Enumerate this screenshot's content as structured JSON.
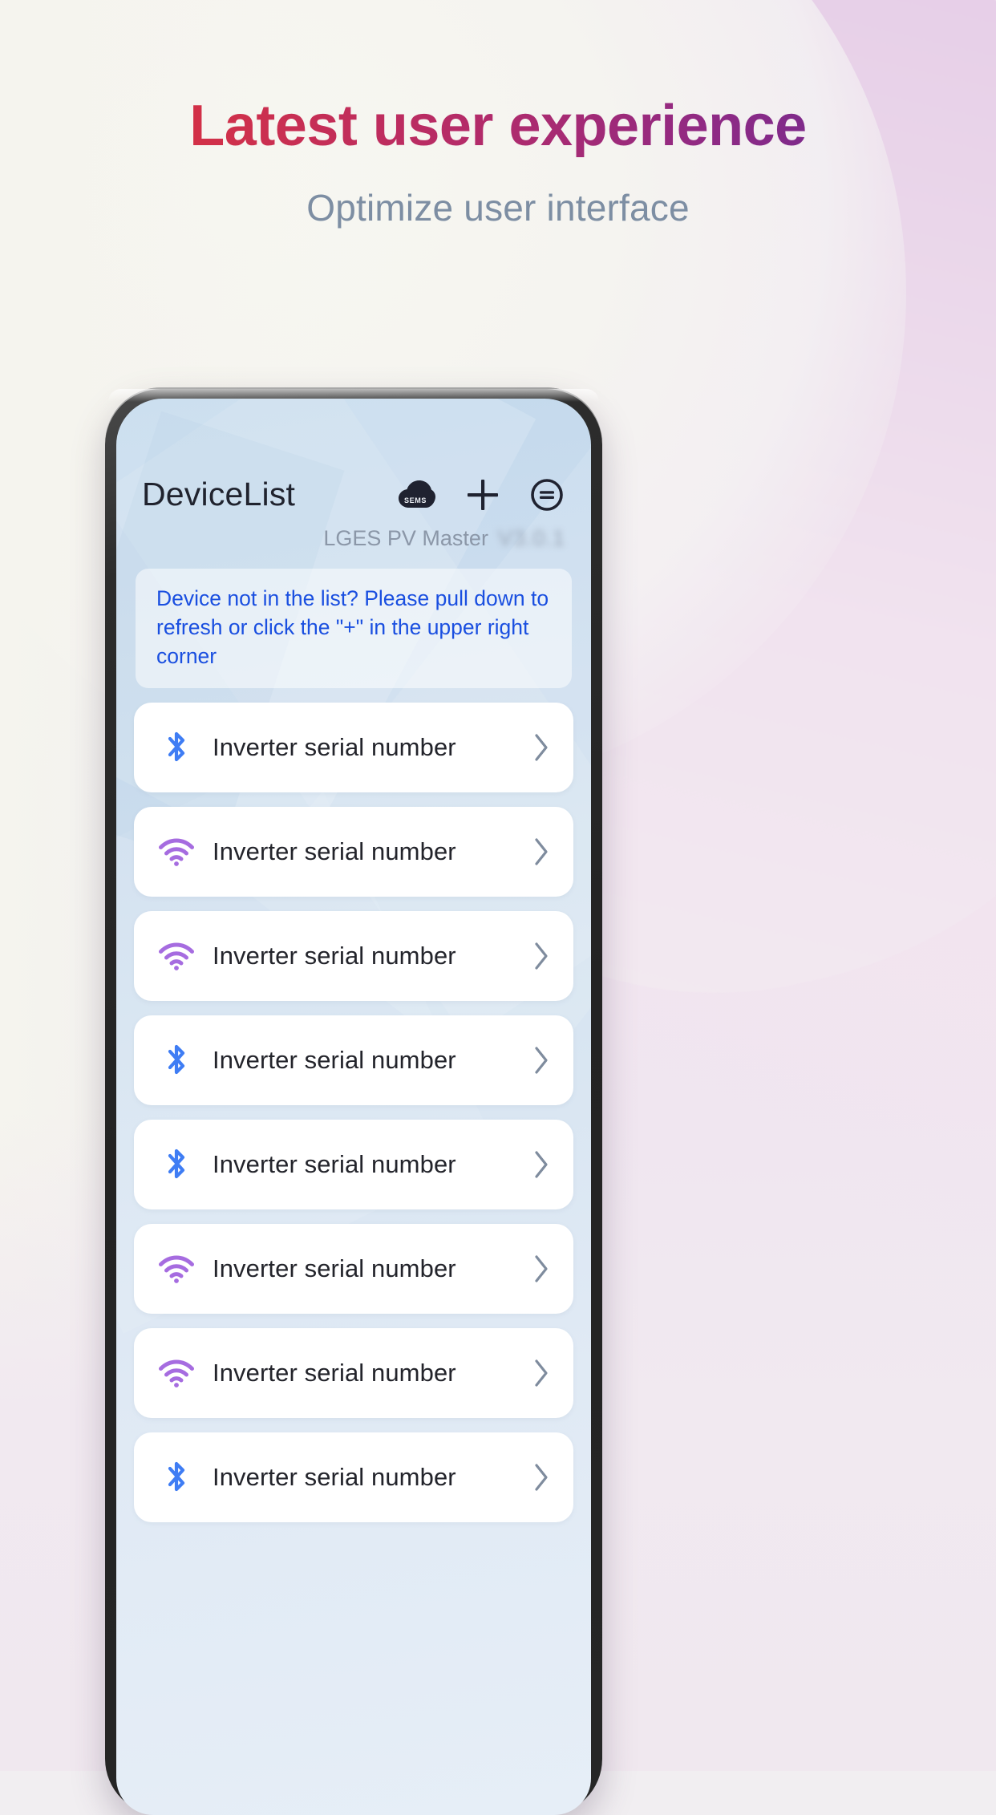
{
  "promo": {
    "title": "Latest user experience",
    "subtitle": "Optimize user interface",
    "title_gradient_start": "#e03131",
    "title_gradient_end": "#5e2b96",
    "subtitle_color": "#7d8ea3"
  },
  "app": {
    "header": {
      "title": "DeviceList",
      "icons": [
        {
          "name": "sems-cloud-icon",
          "label": "SEMS"
        },
        {
          "name": "add-device-icon",
          "label": "+"
        },
        {
          "name": "menu-circle-icon",
          "label": "menu"
        }
      ]
    },
    "version": {
      "app_name": "LGES PV Master",
      "version_number": "V3.0.1"
    },
    "info_banner": {
      "line1": "Device not in the list? Please pull down to",
      "line2": "refresh or click the \"+\" in the upper right corner",
      "text_color": "#1a4fe0"
    },
    "devices": [
      {
        "icon": "bluetooth-icon",
        "label": "Inverter serial number",
        "chevron": "›"
      },
      {
        "icon": "wifi-icon",
        "label": "Inverter serial number",
        "chevron": "›"
      },
      {
        "icon": "wifi-icon",
        "label": "Inverter serial number",
        "chevron": "›"
      },
      {
        "icon": "bluetooth-icon",
        "label": "Inverter serial number",
        "chevron": "›"
      },
      {
        "icon": "bluetooth-icon",
        "label": "Inverter serial number",
        "chevron": "›"
      },
      {
        "icon": "wifi-icon",
        "label": "Inverter serial number",
        "chevron": "›"
      },
      {
        "icon": "wifi-icon",
        "label": "Inverter serial number",
        "chevron": "›"
      },
      {
        "icon": "bluetooth-icon",
        "label": "Inverter serial number",
        "chevron": "›"
      }
    ],
    "colors": {
      "bluetooth": "#3f7df4",
      "wifi": "#a66ce0",
      "chevron": "#7f8c9e",
      "row_background": "#ffffff",
      "title": "#20232e"
    }
  }
}
